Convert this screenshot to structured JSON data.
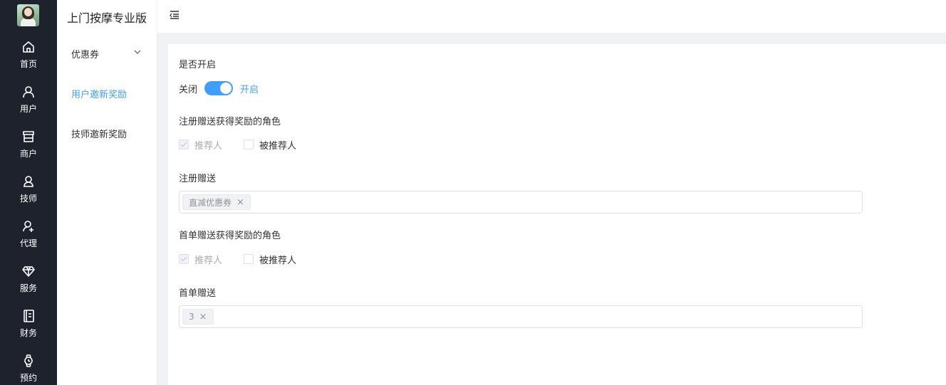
{
  "app_title": "上门按摩专业版",
  "rail": {
    "items": [
      {
        "label": "首页",
        "icon": "home-icon"
      },
      {
        "label": "用户",
        "icon": "user-icon"
      },
      {
        "label": "商户",
        "icon": "shop-icon"
      },
      {
        "label": "技师",
        "icon": "technician-icon"
      },
      {
        "label": "代理",
        "icon": "agent-icon"
      },
      {
        "label": "服务",
        "icon": "diamond-icon"
      },
      {
        "label": "财务",
        "icon": "ledger-icon"
      },
      {
        "label": "预约",
        "icon": "watch-icon"
      }
    ]
  },
  "submenu": {
    "items": [
      {
        "label": "优惠券",
        "icon": "chevron-down-icon"
      },
      {
        "label": "用户邀新奖励",
        "active": true
      },
      {
        "label": "技师邀新奖励"
      }
    ]
  },
  "form": {
    "enable": {
      "label": "是否开启",
      "off_text": "关闭",
      "on_text": "开启",
      "value": true
    },
    "register_roles": {
      "label": "注册赠送获得奖励的角色",
      "options": [
        {
          "label": "推荐人",
          "checked": true,
          "disabled": true
        },
        {
          "label": "被推荐人",
          "checked": false,
          "disabled": false
        }
      ]
    },
    "register_gift": {
      "label": "注册赠送",
      "tags": [
        "直减优惠券"
      ]
    },
    "first_order_roles": {
      "label": "首单赠送获得奖励的角色",
      "options": [
        {
          "label": "推荐人",
          "checked": true,
          "disabled": true
        },
        {
          "label": "被推荐人",
          "checked": false,
          "disabled": false
        }
      ]
    },
    "first_order_gift": {
      "label": "首单赠送",
      "tags": [
        "3"
      ]
    }
  },
  "colors": {
    "rail_bg": "#1e222d",
    "accent": "#409eff",
    "page_bg": "#f0f2f5"
  }
}
